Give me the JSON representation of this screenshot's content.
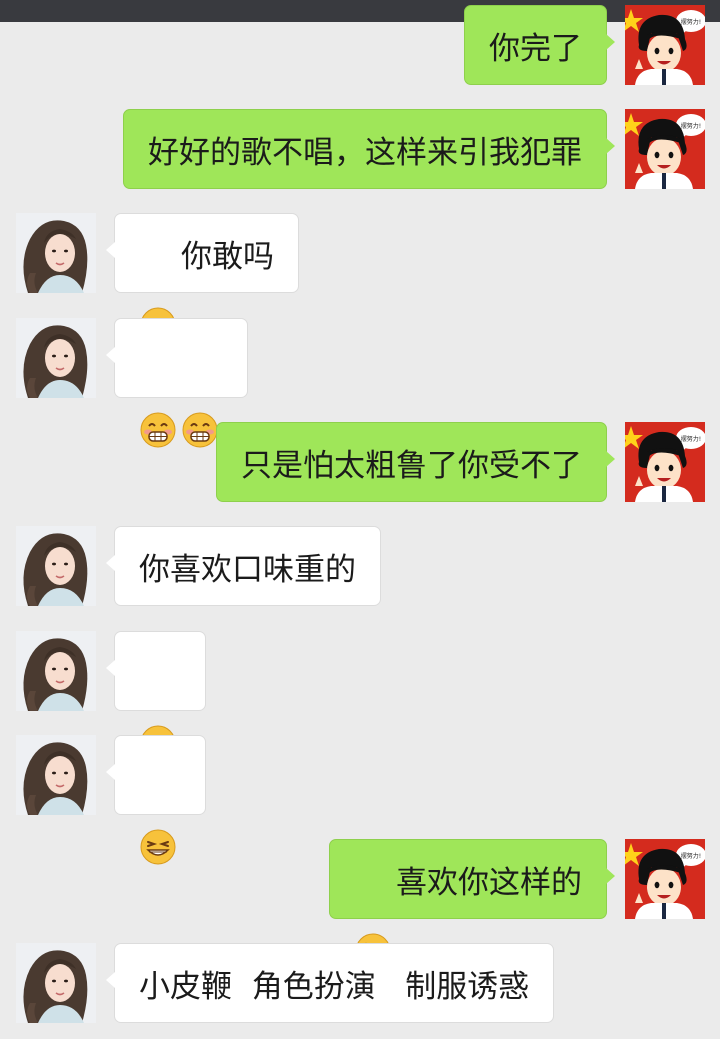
{
  "messages": [
    {
      "side": "out",
      "emoji": [],
      "text": "你完了"
    },
    {
      "side": "out",
      "emoji": [],
      "text": "好好的歌不唱，这样来引我犯罪"
    },
    {
      "side": "in",
      "emoji": [
        "smirk-grin"
      ],
      "text": "你敢吗"
    },
    {
      "side": "in",
      "emoji": [
        "blush-grin",
        "blush-grin"
      ],
      "text": ""
    },
    {
      "side": "out",
      "emoji": [],
      "text": "只是怕太粗鲁了你受不了"
    },
    {
      "side": "in",
      "emoji": [],
      "text": "你喜欢口味重的"
    },
    {
      "side": "in",
      "emoji": [
        "blush-grin"
      ],
      "text": ""
    },
    {
      "side": "in",
      "emoji": [
        "smirk-grin"
      ],
      "text": ""
    },
    {
      "side": "out",
      "emoji": [
        "wink-tongue"
      ],
      "text": "喜欢你这样的"
    },
    {
      "side": "in",
      "emoji": [],
      "text": "小皮鞭  角色扮演   制服诱惑"
    }
  ],
  "my_avatar": {
    "speech_text": "摆努力!"
  },
  "colors": {
    "sent_bubble": "#9fe659",
    "received_bubble": "#ffffff",
    "background": "#ebebeb",
    "status_bar": "#393a3f"
  }
}
